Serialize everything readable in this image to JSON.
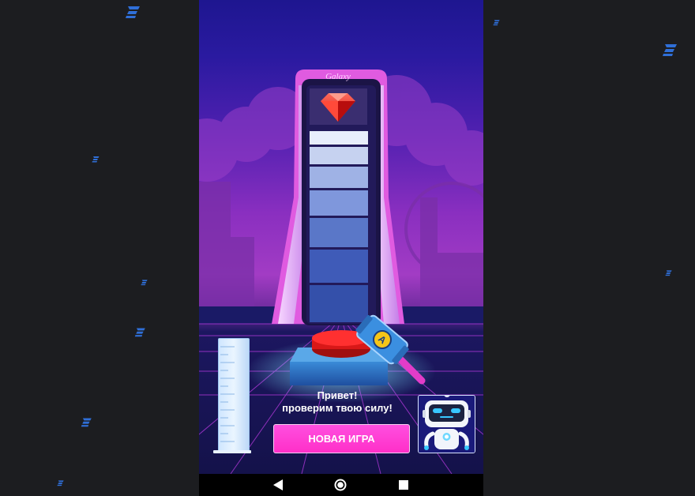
{
  "game": {
    "tower_label": "Galaxy",
    "greeting_line1": "Привет!",
    "greeting_line2": "проверим твою силу!",
    "new_game_button": "НОВАЯ ИГРА",
    "prize_icon": "gem-icon",
    "hammer_badge": "A"
  },
  "navbar": {
    "back_icon": "back-triangle-icon",
    "home_icon": "home-circle-icon",
    "recents_icon": "recents-square-icon"
  },
  "colors": {
    "button_pink": "#ff2fc8",
    "tower_pink": "#e05be0",
    "segment_blue": "#3a5cbf",
    "puck_red": "#e81f1f"
  }
}
